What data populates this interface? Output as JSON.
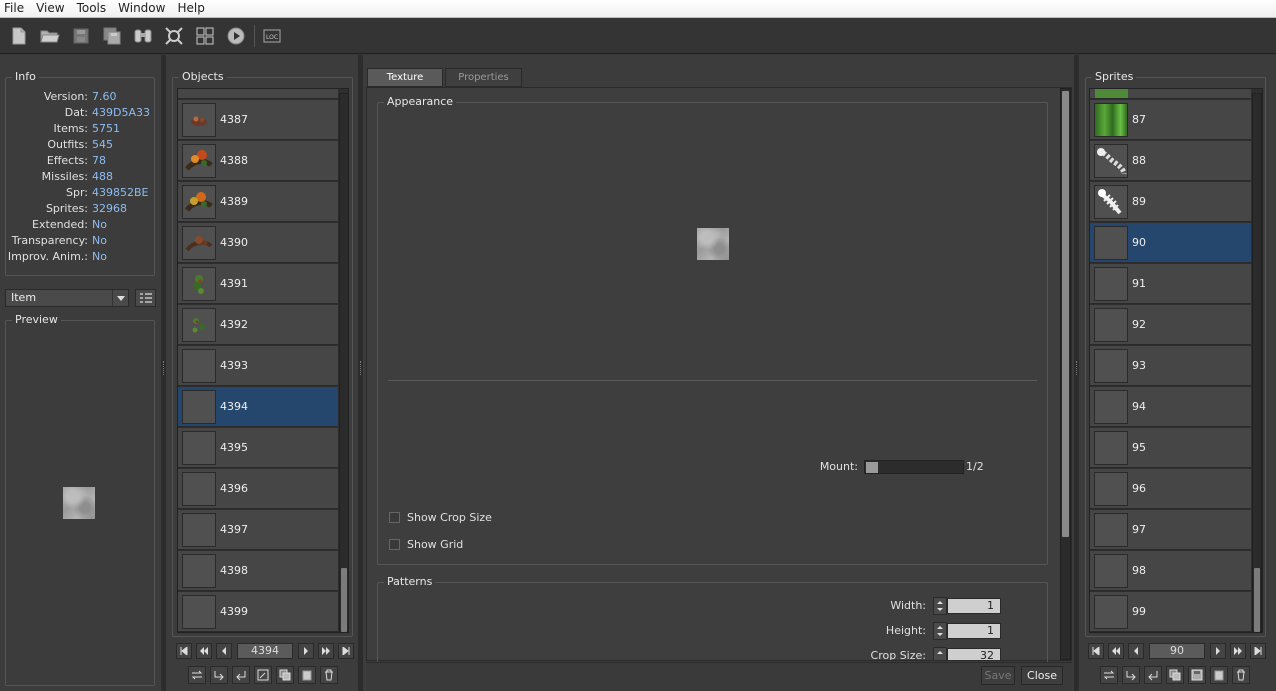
{
  "menu": [
    "File",
    "View",
    "Tools",
    "Window",
    "Help"
  ],
  "toolbar": {
    "icons": [
      "new-file-icon",
      "open-folder-icon",
      "save-icon",
      "save-as-icon",
      "find-icon",
      "zoom-icon",
      "grid-icon",
      "play-icon",
      "localization-icon"
    ]
  },
  "info": {
    "title": "Info",
    "rows": [
      {
        "key": "Version:",
        "value": "7.60"
      },
      {
        "key": "Dat:",
        "value": "439D5A33"
      },
      {
        "key": "Items:",
        "value": "5751"
      },
      {
        "key": "Outfits:",
        "value": "545"
      },
      {
        "key": "Effects:",
        "value": "78"
      },
      {
        "key": "Missiles:",
        "value": "488"
      },
      {
        "key": "Spr:",
        "value": "439852BE"
      },
      {
        "key": "Sprites:",
        "value": "32968"
      },
      {
        "key": "Extended:",
        "value": "No"
      },
      {
        "key": "Transparency:",
        "value": "No"
      },
      {
        "key": "Improv. Anim.:",
        "value": "No"
      }
    ]
  },
  "category_select": {
    "selected": "Item"
  },
  "preview": {
    "title": "Preview"
  },
  "objects": {
    "title": "Objects",
    "items": [
      "4387",
      "4388",
      "4389",
      "4390",
      "4391",
      "4392",
      "4393",
      "4394",
      "4395",
      "4396",
      "4397",
      "4398",
      "4399"
    ],
    "selected": "4394",
    "page_field": "4394"
  },
  "editor": {
    "tabs": [
      "Texture",
      "Properties"
    ],
    "active_tab": "Texture",
    "appearance_title": "Appearance",
    "mount_label": "Mount:",
    "mount_value": "1/2",
    "mount_slider": 0.0,
    "show_crop_size": "Show Crop Size",
    "show_grid": "Show Grid",
    "patterns_title": "Patterns",
    "width_label": "Width:",
    "width_value": "1",
    "height_label": "Height:",
    "height_value": "1",
    "crop_label": "Crop Size:",
    "crop_value": "32",
    "save_label": "Save",
    "close_label": "Close"
  },
  "sprites": {
    "title": "Sprites",
    "items": [
      "87",
      "88",
      "89",
      "90",
      "91",
      "92",
      "93",
      "94",
      "95",
      "96",
      "97",
      "98",
      "99"
    ],
    "selected": "90",
    "page_field": "90"
  }
}
